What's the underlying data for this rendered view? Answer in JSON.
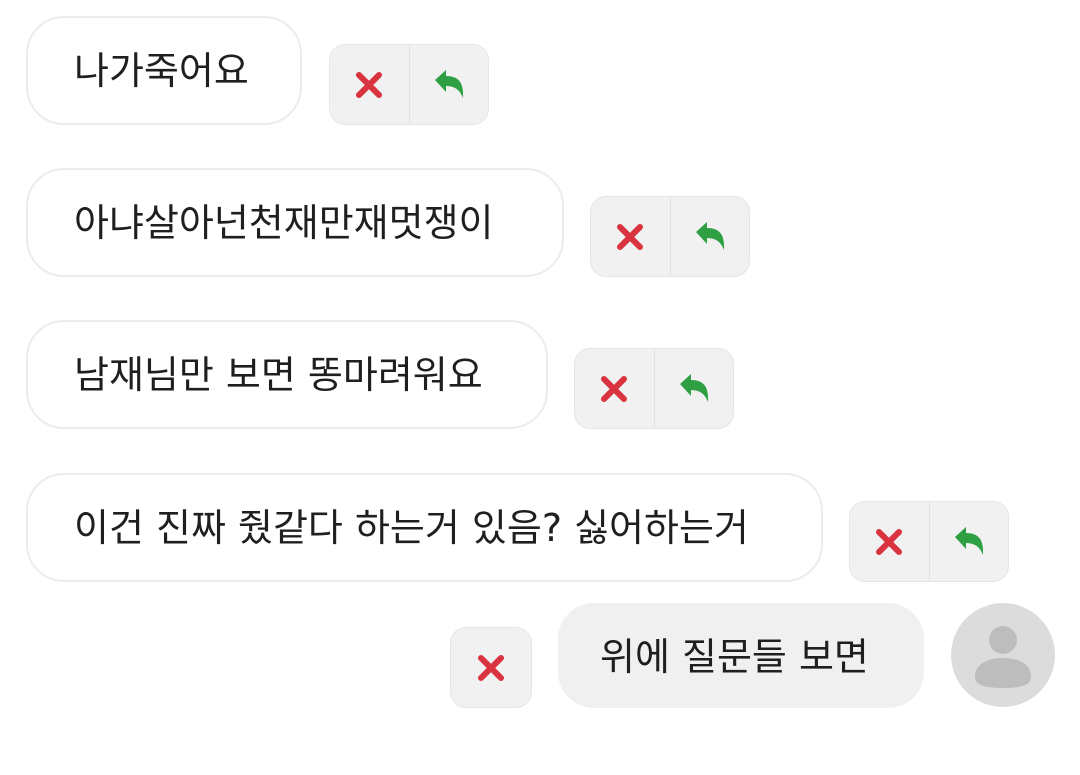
{
  "messages": [
    {
      "text": "나가죽어요",
      "delete_icon": "close-icon",
      "reply_icon": "reply-icon"
    },
    {
      "text": "아냐살아넌천재만재멋쟁이",
      "delete_icon": "close-icon",
      "reply_icon": "reply-icon"
    },
    {
      "text": "남재님만 보면 똥마려워요",
      "delete_icon": "close-icon",
      "reply_icon": "reply-icon"
    },
    {
      "text": "이건 진짜 줬같다 하는거 있음? 싫어하는거",
      "delete_icon": "close-icon",
      "reply_icon": "reply-icon"
    }
  ],
  "my_message": {
    "text": "위에 질문들 보면",
    "delete_icon": "close-icon",
    "avatar_icon": "user-avatar-icon"
  },
  "colors": {
    "delete": "#d8333f",
    "reply": "#2ea043",
    "bubble_border": "#ececec",
    "my_bubble": "#f0f0f0",
    "avatar": "#dcdcdc"
  }
}
